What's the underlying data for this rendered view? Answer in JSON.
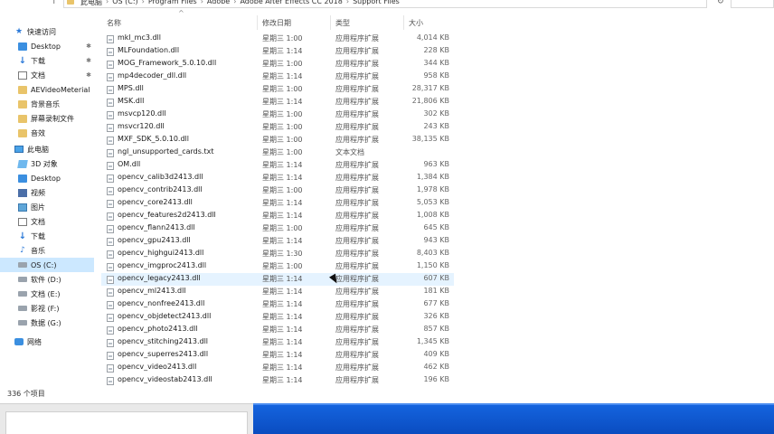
{
  "address": {
    "back_glyph": "↑",
    "crumbs": [
      "此电脑",
      "OS (C:)",
      "Program Files",
      "Adobe",
      "Adobe After Effects CC 2018",
      "Support Files"
    ],
    "separator": "›",
    "refresh_glyph": "↻"
  },
  "nav": {
    "quick_access": "快速访问",
    "items": [
      {
        "label": "Desktop",
        "icon": "desktop-icon",
        "pinned": true
      },
      {
        "label": "下载",
        "icon": "download-icon",
        "pinned": true
      },
      {
        "label": "文档",
        "icon": "document-icon",
        "pinned": true
      },
      {
        "label": "AEVideoMeterial",
        "icon": "folder-icon",
        "pinned": false
      },
      {
        "label": "背景音乐",
        "icon": "folder-icon",
        "pinned": false
      },
      {
        "label": "屏幕录制文件",
        "icon": "folder-icon",
        "pinned": false
      },
      {
        "label": "音效",
        "icon": "folder-icon",
        "pinned": false
      }
    ],
    "this_pc": "此电脑",
    "pc_items": [
      {
        "label": "3D 对象",
        "icon": "3d-objects-icon"
      },
      {
        "label": "Desktop",
        "icon": "desktop-icon"
      },
      {
        "label": "视频",
        "icon": "video-icon"
      },
      {
        "label": "图片",
        "icon": "pictures-icon"
      },
      {
        "label": "文档",
        "icon": "document-icon"
      },
      {
        "label": "下载",
        "icon": "download-icon"
      },
      {
        "label": "音乐",
        "icon": "music-icon"
      },
      {
        "label": "OS (C:)",
        "icon": "drive-icon"
      },
      {
        "label": "软件 (D:)",
        "icon": "drive-icon"
      },
      {
        "label": "文档 (E:)",
        "icon": "drive-icon"
      },
      {
        "label": "影视 (F:)",
        "icon": "drive-icon"
      },
      {
        "label": "数据 (G:)",
        "icon": "drive-icon"
      }
    ],
    "network": "网络",
    "pin_glyph": "✱"
  },
  "columns": {
    "name": "名称",
    "date": "修改日期",
    "type": "类型",
    "size": "大小",
    "sort_glyph": "^"
  },
  "files": [
    {
      "name": "mkl_mc3.dll",
      "date": "星期三 1:00",
      "type": "应用程序扩展",
      "size": "4,014 KB"
    },
    {
      "name": "MLFoundation.dll",
      "date": "星期三 1:14",
      "type": "应用程序扩展",
      "size": "228 KB"
    },
    {
      "name": "MOG_Framework_5.0.10.dll",
      "date": "星期三 1:00",
      "type": "应用程序扩展",
      "size": "344 KB"
    },
    {
      "name": "mp4decoder_dll.dll",
      "date": "星期三 1:14",
      "type": "应用程序扩展",
      "size": "958 KB"
    },
    {
      "name": "MPS.dll",
      "date": "星期三 1:00",
      "type": "应用程序扩展",
      "size": "28,317 KB"
    },
    {
      "name": "MSK.dll",
      "date": "星期三 1:14",
      "type": "应用程序扩展",
      "size": "21,806 KB"
    },
    {
      "name": "msvcp120.dll",
      "date": "星期三 1:00",
      "type": "应用程序扩展",
      "size": "302 KB"
    },
    {
      "name": "msvcr120.dll",
      "date": "星期三 1:00",
      "type": "应用程序扩展",
      "size": "243 KB"
    },
    {
      "name": "MXF_SDK_5.0.10.dll",
      "date": "星期三 1:00",
      "type": "应用程序扩展",
      "size": "38,135 KB"
    },
    {
      "name": "ngl_unsupported_cards.txt",
      "date": "星期三 1:00",
      "type": "文本文档",
      "size": ""
    },
    {
      "name": "OM.dll",
      "date": "星期三 1:14",
      "type": "应用程序扩展",
      "size": "963 KB"
    },
    {
      "name": "opencv_calib3d2413.dll",
      "date": "星期三 1:14",
      "type": "应用程序扩展",
      "size": "1,384 KB"
    },
    {
      "name": "opencv_contrib2413.dll",
      "date": "星期三 1:00",
      "type": "应用程序扩展",
      "size": "1,978 KB"
    },
    {
      "name": "opencv_core2413.dll",
      "date": "星期三 1:14",
      "type": "应用程序扩展",
      "size": "5,053 KB"
    },
    {
      "name": "opencv_features2d2413.dll",
      "date": "星期三 1:14",
      "type": "应用程序扩展",
      "size": "1,008 KB"
    },
    {
      "name": "opencv_flann2413.dll",
      "date": "星期三 1:00",
      "type": "应用程序扩展",
      "size": "645 KB"
    },
    {
      "name": "opencv_gpu2413.dll",
      "date": "星期三 1:14",
      "type": "应用程序扩展",
      "size": "943 KB"
    },
    {
      "name": "opencv_highgui2413.dll",
      "date": "星期三 1:30",
      "type": "应用程序扩展",
      "size": "8,403 KB"
    },
    {
      "name": "opencv_imgproc2413.dll",
      "date": "星期三 1:00",
      "type": "应用程序扩展",
      "size": "1,150 KB"
    },
    {
      "name": "opencv_legacy2413.dll",
      "date": "星期三 1:14",
      "type": "应用程序扩展",
      "size": "607 KB"
    },
    {
      "name": "opencv_ml2413.dll",
      "date": "星期三 1:14",
      "type": "应用程序扩展",
      "size": "181 KB"
    },
    {
      "name": "opencv_nonfree2413.dll",
      "date": "星期三 1:14",
      "type": "应用程序扩展",
      "size": "677 KB"
    },
    {
      "name": "opencv_objdetect2413.dll",
      "date": "星期三 1:14",
      "type": "应用程序扩展",
      "size": "326 KB"
    },
    {
      "name": "opencv_photo2413.dll",
      "date": "星期三 1:14",
      "type": "应用程序扩展",
      "size": "857 KB"
    },
    {
      "name": "opencv_stitching2413.dll",
      "date": "星期三 1:14",
      "type": "应用程序扩展",
      "size": "1,345 KB"
    },
    {
      "name": "opencv_superres2413.dll",
      "date": "星期三 1:14",
      "type": "应用程序扩展",
      "size": "409 KB"
    },
    {
      "name": "opencv_video2413.dll",
      "date": "星期三 1:14",
      "type": "应用程序扩展",
      "size": "462 KB"
    },
    {
      "name": "opencv_videostab2413.dll",
      "date": "星期三 1:14",
      "type": "应用程序扩展",
      "size": "196 KB"
    }
  ],
  "hover_row_index": 19,
  "status": {
    "item_count": "336 个项目"
  },
  "colors": {
    "selection": "#cce8ff",
    "hover": "#e5f3ff",
    "desktop": "#1565e0"
  }
}
